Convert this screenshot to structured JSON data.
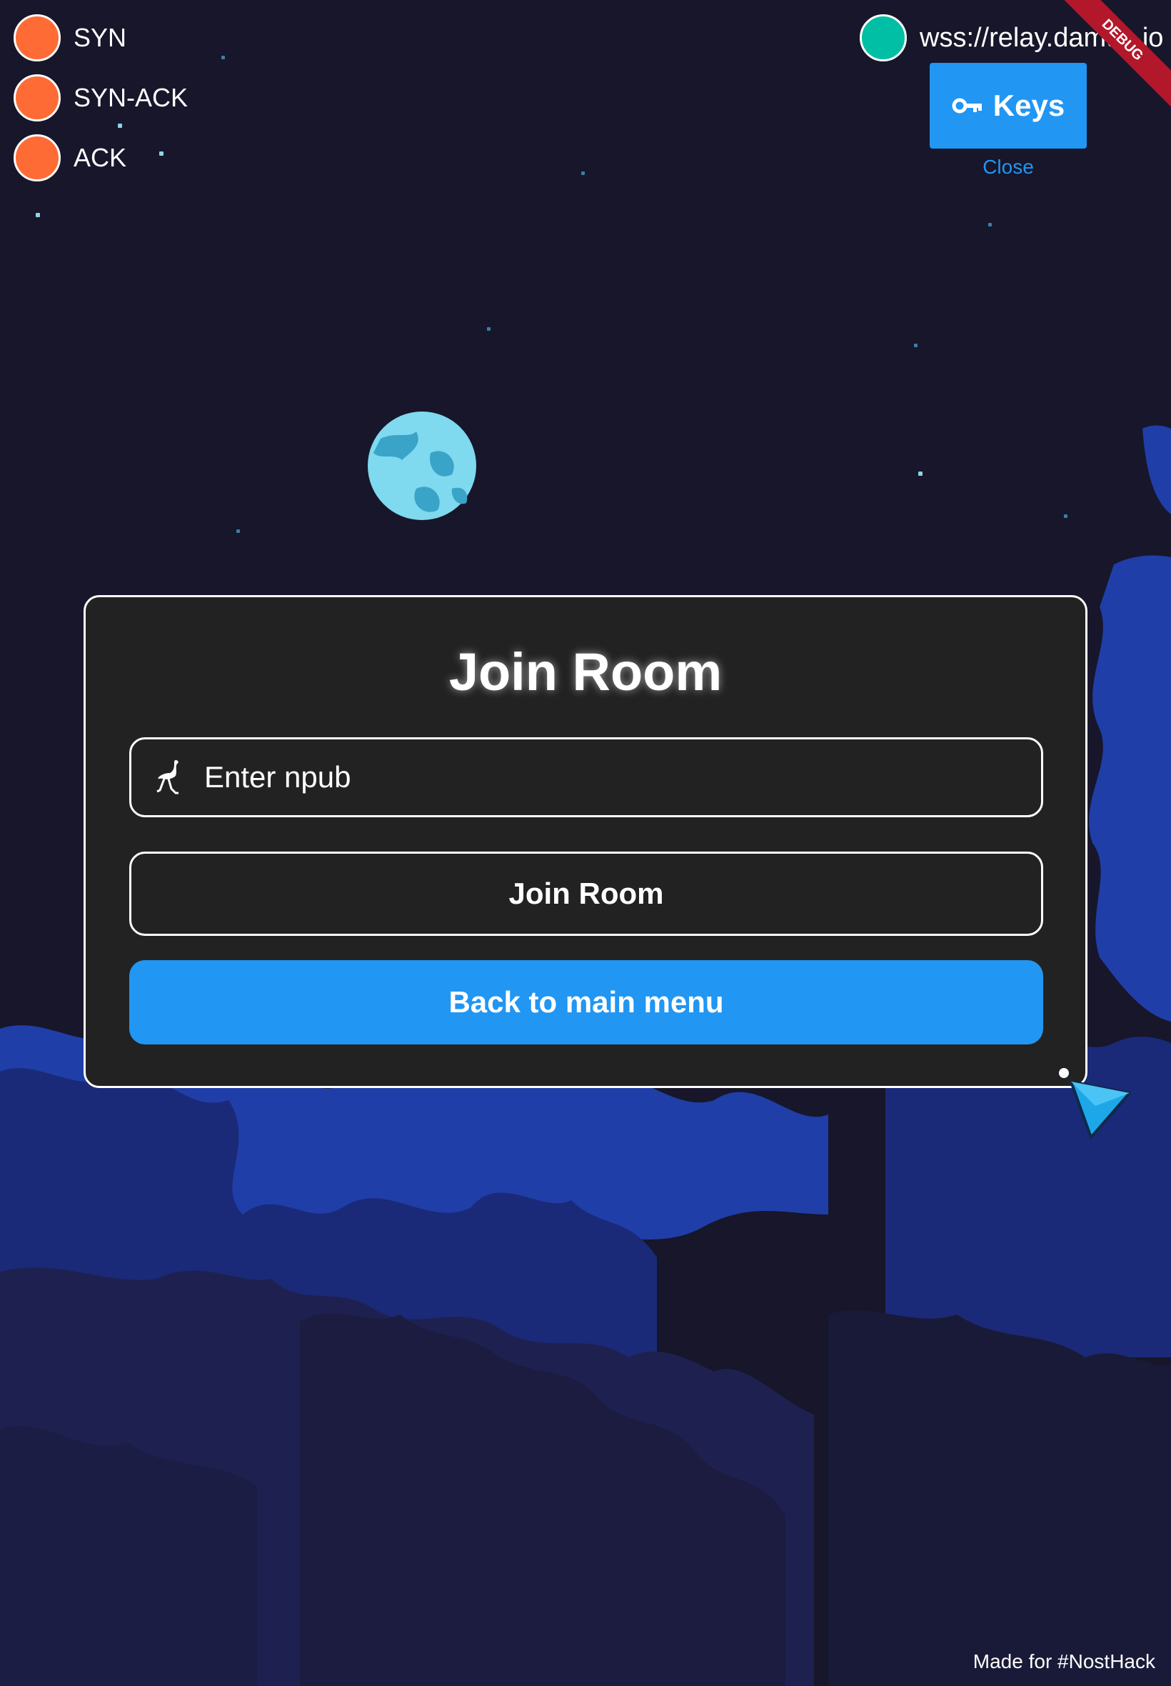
{
  "handshake": [
    {
      "label": "SYN",
      "color": "#ff6b35"
    },
    {
      "label": "SYN-ACK",
      "color": "#ff6b35"
    },
    {
      "label": "ACK",
      "color": "#ff6b35"
    }
  ],
  "relay": {
    "url": "wss://relay.damus.io",
    "status_color": "#00bfa5"
  },
  "keys_button": {
    "label": "Keys",
    "icon": "key-icon"
  },
  "close_link": {
    "label": "Close"
  },
  "debug_banner": "DEBUG",
  "dialog": {
    "title": "Join Room",
    "npub_input": {
      "placeholder": "Enter npub",
      "value": "",
      "icon": "ostrich-icon"
    },
    "join_button": "Join Room",
    "back_button": "Back to main menu"
  },
  "footer": "Made for #NostHack",
  "colors": {
    "accent": "#2196f3",
    "background": "#17162a",
    "dialog": "#222222"
  }
}
